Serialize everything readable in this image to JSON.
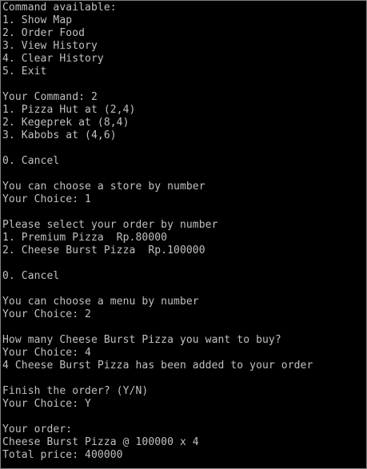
{
  "console": {
    "lines": [
      "Command available:",
      "1. Show Map",
      "2. Order Food",
      "3. View History",
      "4. Clear History",
      "5. Exit",
      "",
      "Your Command: 2",
      "1. Pizza Hut at (2,4)",
      "2. Kegeprek at (8,4)",
      "3. Kabobs at (4,6)",
      "",
      "0. Cancel",
      "",
      "You can choose a store by number",
      "Your Choice: 1",
      "",
      "Please select your order by number",
      "1. Premium Pizza  Rp.80000",
      "2. Cheese Burst Pizza  Rp.100000",
      "",
      "0. Cancel",
      "",
      "You can choose a menu by number",
      "Your Choice: 2",
      "",
      "How many Cheese Burst Pizza you want to buy?",
      "Your Choice: 4",
      "4 Cheese Burst Pizza has been added to your order",
      "",
      "Finish the order? (Y/N)",
      "Your Choice: Y",
      "",
      "Your order:",
      "Cheese Burst Pizza @ 100000 x 4",
      "Total price: 400000"
    ]
  }
}
